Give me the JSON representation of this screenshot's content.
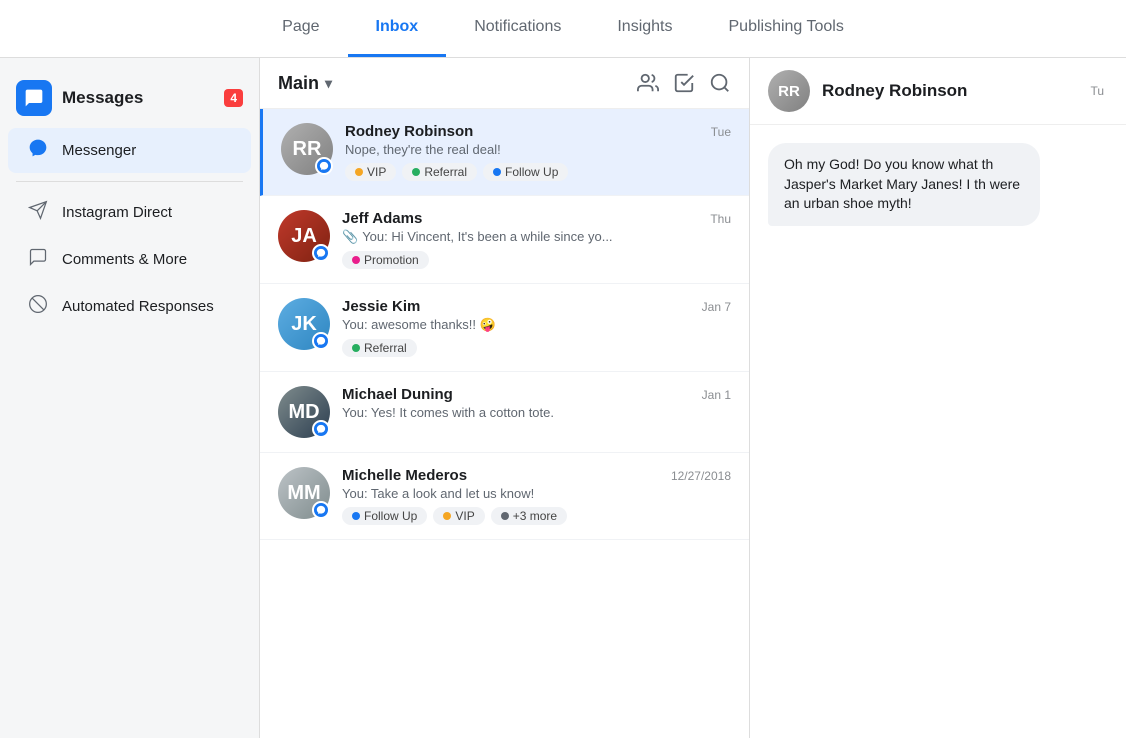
{
  "topNav": {
    "tabs": [
      {
        "id": "page",
        "label": "Page",
        "active": false
      },
      {
        "id": "inbox",
        "label": "Inbox",
        "active": true
      },
      {
        "id": "notifications",
        "label": "Notifications",
        "active": false
      },
      {
        "id": "insights",
        "label": "Insights",
        "active": false
      },
      {
        "id": "publishing-tools",
        "label": "Publishing Tools",
        "active": false
      }
    ]
  },
  "sidebar": {
    "header": {
      "title": "Messages",
      "badge": "4"
    },
    "items": [
      {
        "id": "messenger",
        "label": "Messenger",
        "icon": "💬",
        "active": true
      },
      {
        "id": "instagram-direct",
        "label": "Instagram Direct",
        "icon": "✈",
        "active": false
      },
      {
        "id": "comments-more",
        "label": "Comments & More",
        "icon": "💬",
        "active": false
      },
      {
        "id": "automated-responses",
        "label": "Automated Responses",
        "icon": "⊗",
        "active": false
      }
    ]
  },
  "inbox": {
    "title": "Main",
    "conversations": [
      {
        "id": 1,
        "name": "Rodney Robinson",
        "preview": "Nope, they're the real deal!",
        "time": "Tue",
        "selected": true,
        "avatarClass": "avatar-rodney",
        "avatarInitials": "RR",
        "tags": [
          {
            "label": "VIP",
            "color": "#f5a623"
          },
          {
            "label": "Referral",
            "color": "#27ae60"
          },
          {
            "label": "Follow Up",
            "color": "#1877f2"
          }
        ]
      },
      {
        "id": 2,
        "name": "Jeff Adams",
        "preview": "You: Hi Vincent, It's been a while since yo...",
        "time": "Thu",
        "selected": false,
        "avatarClass": "avatar-jeff",
        "avatarInitials": "JA",
        "tags": [
          {
            "label": "Promotion",
            "color": "#e91e8c"
          }
        ]
      },
      {
        "id": 3,
        "name": "Jessie Kim",
        "preview": "You: awesome thanks!! 🤪",
        "time": "Jan 7",
        "selected": false,
        "avatarClass": "avatar-jessie",
        "avatarInitials": "JK",
        "tags": [
          {
            "label": "Referral",
            "color": "#27ae60"
          }
        ]
      },
      {
        "id": 4,
        "name": "Michael Duning",
        "preview": "You: Yes! It comes with a cotton tote.",
        "time": "Jan 1",
        "selected": false,
        "avatarClass": "avatar-michael",
        "avatarInitials": "MD",
        "tags": []
      },
      {
        "id": 5,
        "name": "Michelle Mederos",
        "preview": "You: Take a look and let us know!",
        "time": "12/27/2018",
        "selected": false,
        "avatarClass": "avatar-michelle",
        "avatarInitials": "MM",
        "tags": [
          {
            "label": "Follow Up",
            "color": "#1877f2"
          },
          {
            "label": "VIP",
            "color": "#f5a623"
          },
          {
            "label": "+3 more",
            "color": "#606770"
          }
        ]
      }
    ]
  },
  "rightPanel": {
    "contact": {
      "name": "Rodney Robinson",
      "timeLabel": "Tu"
    },
    "messages": [
      {
        "id": 1,
        "text": "Oh my God! Do you know what th Jasper's Market Mary Janes! I th were an urban shoe myth!",
        "type": "received"
      }
    ]
  }
}
